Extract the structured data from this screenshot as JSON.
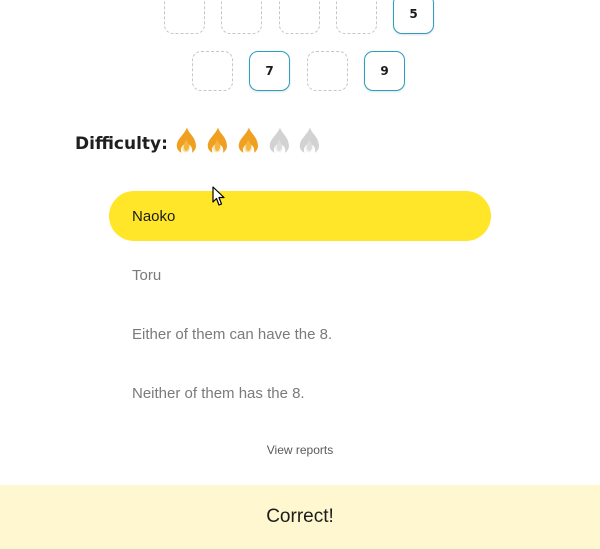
{
  "cards": {
    "row1": [
      {
        "value": "",
        "state": "empty"
      },
      {
        "value": "",
        "state": "empty"
      },
      {
        "value": "",
        "state": "empty"
      },
      {
        "value": "",
        "state": "empty"
      },
      {
        "value": "5",
        "state": "filled"
      }
    ],
    "row2": [
      {
        "value": "",
        "state": "empty"
      },
      {
        "value": "7",
        "state": "filled"
      },
      {
        "value": "",
        "state": "empty"
      },
      {
        "value": "9",
        "state": "filled"
      }
    ]
  },
  "difficulty": {
    "label": "Difficulty:",
    "rating": 3,
    "max": 5,
    "active_color": "#f0a020",
    "inactive_color": "#d2d2d2"
  },
  "answers": {
    "options": [
      {
        "label": "Naoko",
        "selected": true
      },
      {
        "label": "Toru",
        "selected": false
      },
      {
        "label": "Either of them can have the 8.",
        "selected": false
      },
      {
        "label": "Neither of them has the 8.",
        "selected": false
      }
    ],
    "selected_color": "#ffe628"
  },
  "view_reports": "View reports",
  "result": {
    "text": "Correct!",
    "background": "#fff7cf"
  }
}
